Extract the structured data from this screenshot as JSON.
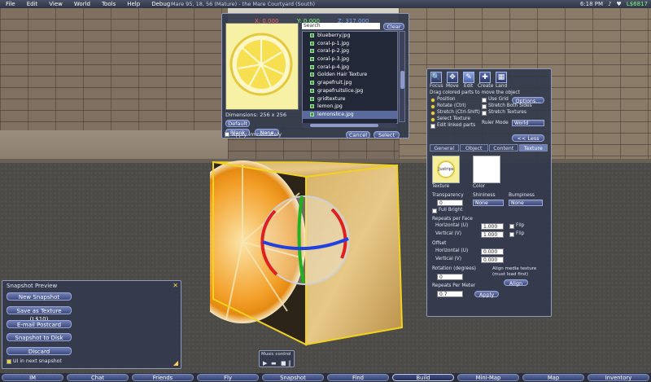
{
  "menubar": {
    "items": [
      "File",
      "Edit",
      "View",
      "World",
      "Tools",
      "Help",
      "Debug"
    ],
    "location": "Mare 95, 18, 56 (Mature) - the Mare Courtyard (South)",
    "time": "6:18 PM",
    "balance": "L$6817"
  },
  "texture_picker": {
    "coords": {
      "x": "X: 0.000",
      "y": "Y: 0.000",
      "z": "Z: 317.000"
    },
    "search_placeholder": "Search",
    "clear_label": "Clear",
    "files": [
      "blueberry.jpg",
      "coral-p-1.jpg",
      "coral-p-2.jpg",
      "coral-p-3.jpg",
      "coral-p-4.jpg",
      "Golden Hair Texture",
      "grapefruit.jpg",
      "grapefruitslice.jpg",
      "gridtexture",
      "lemon.jpg",
      "lemonslice.jpg"
    ],
    "selected_file": "lemonslice.jpg",
    "dimensions": "Dimensions: 256 x 256",
    "default_label": "Default",
    "blank_label": "Blank",
    "none_label": "None",
    "apply_immediately": "Apply immediately",
    "cancel_label": "Cancel",
    "select_label": "Select"
  },
  "build_tools": {
    "tools": [
      "Focus",
      "Move",
      "Edit",
      "Create",
      "Land"
    ],
    "tool_glyphs": [
      "🔍",
      "✥",
      "✎",
      "✚",
      "▦"
    ],
    "options": [
      {
        "label": "Drag colored parts to move the object",
        "type": "text"
      },
      {
        "label": "Position",
        "type": "radio"
      },
      {
        "label": "Rotate (Ctrl)",
        "type": "radio"
      },
      {
        "label": "Stretch (Ctrl-Shift)",
        "type": "radio"
      },
      {
        "label": "Select Texture",
        "type": "radio"
      },
      {
        "label": "Edit linked parts",
        "type": "check"
      }
    ],
    "right_options": [
      "Use Grid",
      "Stretch Both Sides",
      "Stretch Textures"
    ],
    "options_label": "Options...",
    "ruler_mode_label": "Ruler Mode",
    "ruler_mode_value": "World",
    "less_label": "<< Less",
    "tabs": [
      "General",
      "Object",
      "Content",
      "Texture"
    ],
    "active_tab": "Texture",
    "texture_label": "Texture",
    "color_label": "Color",
    "texture_thumb_text": "Justrips",
    "transparency_label": "Transparency",
    "transparency_value": "0",
    "shininess_label": "Shininess",
    "shininess_value": "None",
    "bumpiness_label": "Bumpiness",
    "bumpiness_value": "None",
    "full_bright": "Full Bright",
    "repeats_label": "Repeats per Face",
    "horizontal_label": "Horizontal (U)",
    "vertical_label": "Vertical (V)",
    "repeats_h": "1.000",
    "repeats_v": "1.000",
    "flip_label": "Flip",
    "offset_label": "Offset",
    "offset_h": "0.000",
    "offset_v": "0.000",
    "rotation_label": "Rotation (degrees)",
    "rotation_value": "0",
    "align_media": "Align media texture (must load first)",
    "align_label": "Align",
    "repeats_per_meter_label": "Repeats Per Meter",
    "repeats_per_meter_value": "0.7",
    "apply_label": "Apply"
  },
  "snapshot": {
    "title": "Snapshot Preview",
    "buttons": [
      "New Snapshot",
      "Save as Texture (L$10)",
      "E-mail Postcard",
      "Snapshot to Disk",
      "Discard"
    ],
    "ui_checkbox": "UI in next snapshot"
  },
  "music": {
    "title": "Music control"
  },
  "toolbar": {
    "buttons": [
      "IM",
      "Chat",
      "Friends",
      "Fly",
      "Snapshot",
      "Find",
      "Build",
      "Mini-Map",
      "Map",
      "Inventory"
    ],
    "active": "Build"
  },
  "colors": {
    "accent": "#6e7fb8",
    "panel": "#343a4c",
    "highlight": "#f0d040"
  }
}
